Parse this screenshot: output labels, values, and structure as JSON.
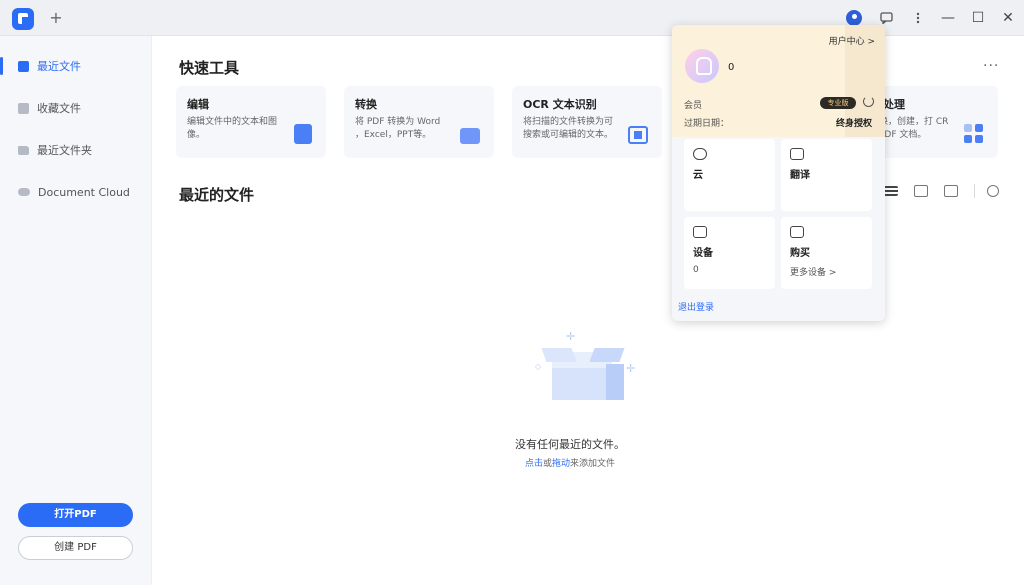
{
  "titlebar": {
    "new_tab": "+",
    "icons": [
      "user-avatar-icon",
      "feedback-icon",
      "more-vertical-icon"
    ],
    "window": {
      "minimize": "—",
      "maximize": "☐",
      "close": "✕"
    }
  },
  "sidebar": {
    "items": [
      {
        "label": "最近文件",
        "icon": "recent-file-icon",
        "active": true
      },
      {
        "label": "收藏文件",
        "icon": "star-file-icon",
        "active": false
      },
      {
        "label": "最近文件夹",
        "icon": "folder-icon",
        "active": false
      },
      {
        "label": "Document Cloud",
        "icon": "cloud-icon",
        "active": false
      }
    ],
    "open_pdf": "打开PDF",
    "create_pdf": "创建 PDF"
  },
  "main": {
    "quick_tools_title": "快速工具",
    "more": "···",
    "tools": [
      {
        "title": "编辑",
        "desc": "编辑文件中的文本和图像。"
      },
      {
        "title": "转换",
        "desc": "将 PDF 转换为 Word ，Excel，PPT等。"
      },
      {
        "title": "OCR 文本识别",
        "desc": "将扫描的文件转换为可搜索或可编辑的文本。"
      },
      {
        "title": "处理",
        "desc": "换，创建，打 CR PDF 文档。"
      }
    ],
    "recent_title": "最近的文件",
    "empty": {
      "title": "没有任何最近的文件。",
      "link1": "点击",
      "or": "或",
      "link2": "拖动",
      "rest": "来添加文件"
    }
  },
  "popup": {
    "user_center": "用户中心 >",
    "username": "0",
    "member_label": "会员",
    "badge": "专业版",
    "expiry_label": "过期日期：",
    "expiry_value": "终身授权",
    "cards": [
      {
        "title": "云",
        "sub": "",
        "icon": "cloud-icon"
      },
      {
        "title": "翻译",
        "sub": "",
        "icon": "translate-icon"
      },
      {
        "title": "设备",
        "sub": "0",
        "icon": "device-icon"
      },
      {
        "title": "购买",
        "sub": "更多设备 >",
        "icon": "cart-icon"
      }
    ],
    "logout": "退出登录"
  },
  "colors": {
    "accent": "#2b6cf6",
    "sidebar_bg": "#f5f7fa",
    "popup_header": "#fcf1da"
  }
}
